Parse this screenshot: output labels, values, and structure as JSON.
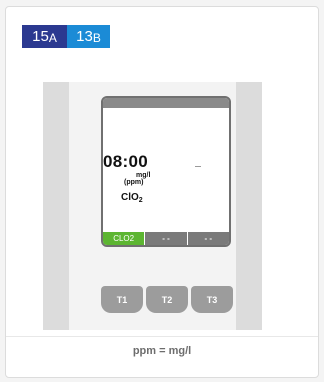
{
  "tag": {
    "a_num": "15",
    "a_sub": "A",
    "b_num": "13",
    "b_sub": "B",
    "a_color": "#2b3990",
    "b_color": "#1b8bd6"
  },
  "display": {
    "time": "08:00",
    "unit_line1": "mg/l",
    "unit_line2": "(ppm)",
    "species_main": "ClO",
    "species_sub": "2",
    "tabs": [
      "CLO2",
      "- -",
      "- -"
    ],
    "active_tab_color": "#5cb531"
  },
  "keys": [
    "T1",
    "T2",
    "T3"
  ],
  "footer": "ppm = mg/l"
}
